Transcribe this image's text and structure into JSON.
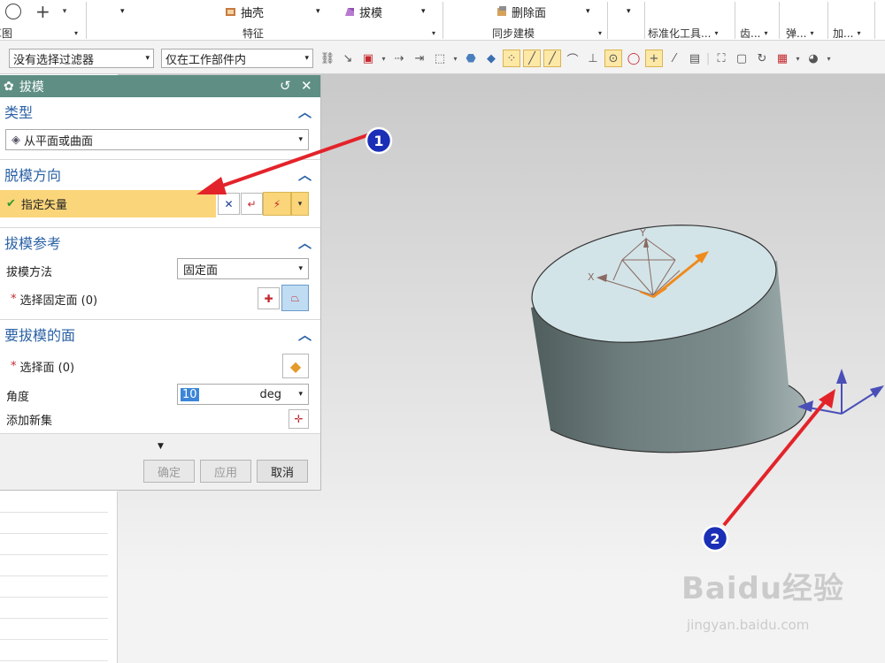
{
  "ribbon": {
    "cmd_shell": "抽壳",
    "cmd_draft": "拔模",
    "cmd_delete_face": "删除面",
    "group_sketch": "草图",
    "group_feature": "特征",
    "group_sync": "同步建模",
    "group_std_tools": "标准化工具...",
    "group_gear": "齿...",
    "group_spring": "弹...",
    "group_add": "加..."
  },
  "toolbar": {
    "filter_value": "没有选择过滤器",
    "scope_value": "仅在工作部件内"
  },
  "dialog": {
    "title": "拔模",
    "type": {
      "header": "类型",
      "value": "从平面或曲面"
    },
    "direction": {
      "header": "脱模方向",
      "specify_vector": "指定矢量"
    },
    "reference": {
      "header": "拔模参考",
      "method_label": "拔模方法",
      "method_value": "固定面",
      "select_fixed": "选择固定面 (0)"
    },
    "faces": {
      "header": "要拔模的面",
      "select_face": "选择面 (0)",
      "angle_label": "角度",
      "angle_value": "10",
      "angle_unit": "deg",
      "add_new_set": "添加新集"
    },
    "buttons": {
      "ok": "确定",
      "apply": "应用",
      "cancel": "取消"
    }
  },
  "annotations": {
    "callout_1": "1",
    "callout_2": "2"
  },
  "axes": {
    "x": "X",
    "y": "Y"
  },
  "watermark": {
    "brand": "Baidu经验",
    "url": "jingyan.baidu.com"
  },
  "colors": {
    "dialog_title_bar": "#5f8f84",
    "section_header": "#2b62a6",
    "highlight_row": "#fad57a",
    "arrow_red": "#e3232a",
    "callout_blue": "#1a2fb6",
    "vector_orange": "#f08a1c",
    "triad_blue": "#4a4fb8"
  }
}
